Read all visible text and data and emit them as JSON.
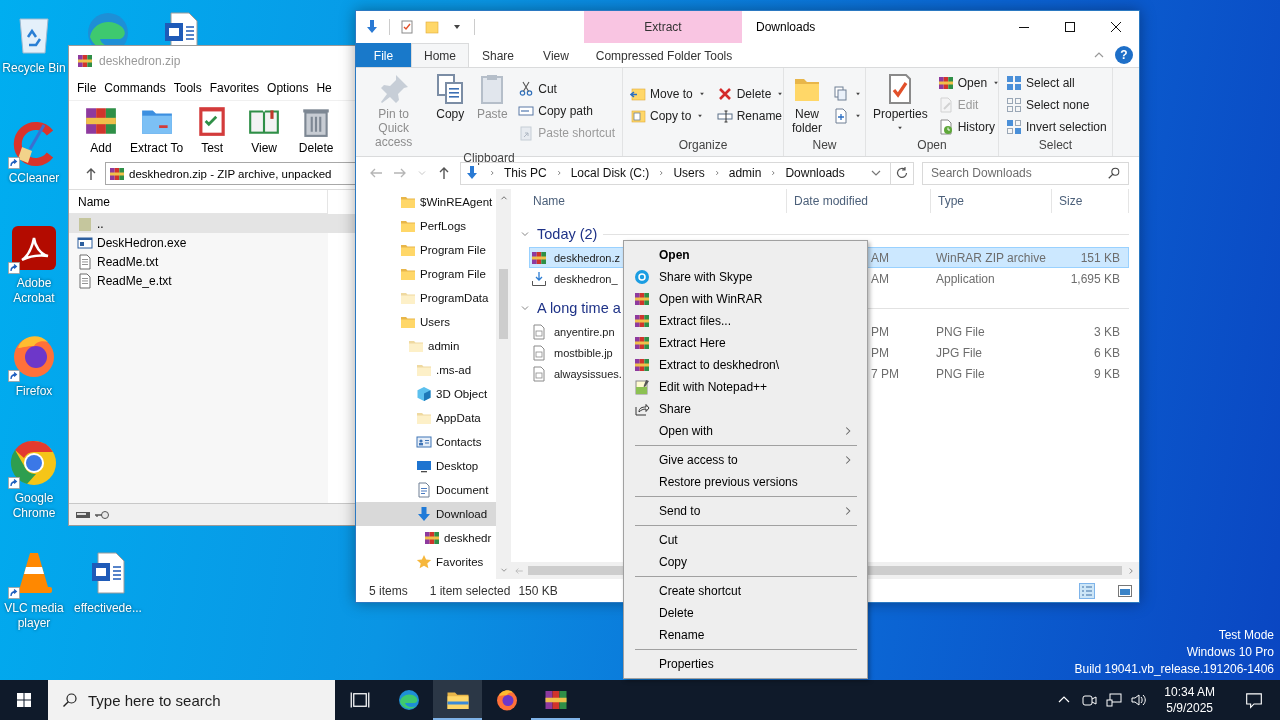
{
  "desktop": {
    "icons": [
      {
        "kind": "recycle",
        "label": "Recycle Bin",
        "shortcut": false
      },
      {
        "kind": "edge"
      },
      {
        "kind": "word"
      },
      {
        "kind": "ccleaner",
        "label": "CCleaner",
        "shortcut": true
      },
      {
        "kind": "acrobat",
        "label": "Adobe Acrobat",
        "shortcut": true
      },
      {
        "kind": "firefox",
        "label": "Firefox",
        "shortcut": true
      },
      {
        "kind": "chrome",
        "label": "Google Chrome",
        "shortcut": true
      },
      {
        "kind": "vlc",
        "label": "VLC media player",
        "shortcut": true
      },
      {
        "kind": "word",
        "label": "effectivede...",
        "shortcut": false
      }
    ],
    "edition_notice": [
      "Test Mode",
      "Windows 10 Pro",
      "Build 19041.vb_release.191206-1406"
    ]
  },
  "winrar": {
    "title": "deskhedron.zip",
    "menu": [
      "File",
      "Commands",
      "Tools",
      "Favorites",
      "Options",
      "He"
    ],
    "toolbar": [
      {
        "kind": "add",
        "label": "Add"
      },
      {
        "kind": "extractto",
        "label": "Extract To"
      },
      {
        "kind": "test",
        "label": "Test"
      },
      {
        "kind": "view",
        "label": "View"
      },
      {
        "kind": "trash",
        "label": "Delete"
      }
    ],
    "address": "deskhedron.zip - ZIP archive, unpacked",
    "columns": [
      "Name"
    ],
    "files": [
      {
        "kind": "up",
        "name": "..",
        "selected": true
      },
      {
        "kind": "exe",
        "name": "DeskHedron.exe",
        "selected": false
      },
      {
        "kind": "txt",
        "name": "ReadMe.txt",
        "selected": false
      },
      {
        "kind": "txt",
        "name": "ReadMe_e.txt",
        "selected": false
      }
    ]
  },
  "explorer": {
    "title": "Downloads",
    "context_tab": "Extract",
    "help_label": "?",
    "tabs": [
      {
        "kind": "file",
        "label": "File",
        "selected": false
      },
      {
        "kind": "normal",
        "label": "Home",
        "selected": true
      },
      {
        "kind": "normal",
        "label": "Share",
        "selected": false
      },
      {
        "kind": "normal",
        "label": "View",
        "selected": false
      },
      {
        "kind": "context",
        "label": "Compressed Folder Tools",
        "selected": false
      }
    ],
    "ribbon": [
      {
        "label": "Clipboard",
        "columns": [
          [
            {
              "kind": "pin",
              "label": "Pin to Quick access",
              "disabled": true,
              "dropdown": false
            }
          ],
          [
            {
              "kind": "copy",
              "label": "Copy",
              "disabled": false,
              "dropdown": false
            }
          ],
          [
            {
              "kind": "paste",
              "label": "Paste",
              "disabled": true,
              "dropdown": false
            }
          ],
          [
            {
              "kind": "cut",
              "label": "Cut",
              "disabled": false,
              "dropdown": false
            },
            {
              "kind": "copypath",
              "label": "Copy path",
              "disabled": false,
              "dropdown": false
            },
            {
              "kind": "pasteshortcut",
              "label": "Paste shortcut",
              "disabled": true,
              "dropdown": false
            }
          ]
        ]
      },
      {
        "label": "Organize",
        "columns": [
          [
            {
              "kind": "moveto",
              "label": "Move to",
              "disabled": false,
              "dropdown": true
            },
            {
              "kind": "copyto",
              "label": "Copy to",
              "disabled": false,
              "dropdown": true
            }
          ],
          [
            {
              "kind": "delete",
              "label": "Delete",
              "disabled": false,
              "dropdown": true
            },
            {
              "kind": "rename",
              "label": "Rename",
              "disabled": false,
              "dropdown": false
            }
          ]
        ]
      },
      {
        "label": "New",
        "columns": [
          [
            {
              "kind": "newfolder",
              "label": "New folder",
              "disabled": false,
              "dropdown": false
            }
          ],
          [
            {
              "kind": "newitem",
              "disabled": false,
              "dropdown": true
            },
            {
              "kind": "easyaccess",
              "disabled": false,
              "dropdown": true
            }
          ]
        ]
      },
      {
        "label": "Open",
        "columns": [
          [
            {
              "kind": "properties",
              "label": "Properties",
              "disabled": false,
              "dropdown": true
            }
          ],
          [
            {
              "kind": "winrar",
              "label": "Open",
              "disabled": false,
              "dropdown": true
            },
            {
              "kind": "edit",
              "label": "Edit",
              "disabled": true,
              "dropdown": false
            },
            {
              "kind": "history",
              "label": "History",
              "disabled": false,
              "dropdown": false
            }
          ]
        ]
      },
      {
        "label": "Select",
        "columns": [
          [
            {
              "kind": "selectall",
              "label": "Select all",
              "disabled": false,
              "dropdown": false
            },
            {
              "kind": "selectnone",
              "label": "Select none",
              "disabled": false,
              "dropdown": false
            },
            {
              "kind": "invert",
              "label": "Invert selection",
              "disabled": false,
              "dropdown": false
            }
          ]
        ]
      }
    ],
    "breadcrumbs": [
      "This PC",
      "Local Disk (C:)",
      "Users",
      "admin",
      "Downloads"
    ],
    "search": {
      "placeholder": "Search Downloads"
    },
    "tree": [
      {
        "kind": "folder",
        "label": "$WinREAgent",
        "selected": false
      },
      {
        "kind": "folder",
        "label": "PerfLogs",
        "selected": false
      },
      {
        "kind": "folder",
        "label": "Program File",
        "selected": false
      },
      {
        "kind": "folder",
        "label": "Program File",
        "selected": false
      },
      {
        "kind": "folderlight",
        "label": "ProgramData",
        "selected": false
      },
      {
        "kind": "folder",
        "label": "Users",
        "selected": false,
        "children": [
          {
            "kind": "folderlight",
            "label": "admin",
            "selected": false,
            "children": [
              {
                "kind": "folderlight",
                "label": ".ms-ad",
                "selected": false
              },
              {
                "kind": "cube",
                "label": "3D Object",
                "selected": false
              },
              {
                "kind": "folderlight",
                "label": "AppData",
                "selected": false
              },
              {
                "kind": "contacts",
                "label": "Contacts",
                "selected": false
              },
              {
                "kind": "desktop",
                "label": "Desktop",
                "selected": false
              },
              {
                "kind": "documents",
                "label": "Document",
                "selected": false
              },
              {
                "kind": "download",
                "label": "Download",
                "selected": true,
                "children": [
                  {
                    "kind": "winrar",
                    "label": "deskhedr",
                    "selected": false
                  }
                ]
              },
              {
                "kind": "star",
                "label": "Favorites",
                "selected": false
              }
            ]
          }
        ]
      }
    ],
    "columns": [
      "Name",
      "Date modified",
      "Type",
      "Size"
    ],
    "groups": [
      {
        "label": "Today (2)",
        "files": [
          {
            "kind": "winrar",
            "name": "deskhedron.z",
            "date": "AM",
            "type": "WinRAR ZIP archive",
            "size": "151 KB",
            "selected": true
          },
          {
            "kind": "installer",
            "name": "deskhedron_",
            "date": "AM",
            "type": "Application",
            "size": "1,695 KB",
            "selected": false
          }
        ]
      },
      {
        "label": "A long time a",
        "files": [
          {
            "kind": "image",
            "name": "anyentire.pn",
            "date": "PM",
            "type": "PNG File",
            "size": "3 KB",
            "selected": false
          },
          {
            "kind": "image",
            "name": "mostbible.jp",
            "date": "PM",
            "type": "JPG File",
            "size": "6 KB",
            "selected": false
          },
          {
            "kind": "image",
            "name": "alwaysissues.",
            "date": "7 PM",
            "type": "PNG File",
            "size": "9 KB",
            "selected": false
          }
        ]
      }
    ],
    "status": {
      "count": "5 items",
      "selection": "1 item selected",
      "size": "150 KB"
    }
  },
  "context_menu": {
    "items": [
      {
        "kind": "plain",
        "label": "Open",
        "default": true,
        "submenu": false
      },
      {
        "kind": "skype",
        "label": "Share with Skype",
        "default": false,
        "submenu": false
      },
      {
        "kind": "winrar",
        "label": "Open with WinRAR",
        "default": false,
        "submenu": false
      },
      {
        "kind": "winrar",
        "label": "Extract files...",
        "default": false,
        "submenu": false
      },
      {
        "kind": "winrar",
        "label": "Extract Here",
        "default": false,
        "submenu": false
      },
      {
        "kind": "winrar",
        "label": "Extract to deskhedron\\",
        "default": false,
        "submenu": false
      },
      {
        "kind": "notepad",
        "label": "Edit with Notepad++",
        "default": false,
        "submenu": false
      },
      {
        "kind": "share",
        "label": "Share",
        "default": false,
        "submenu": false
      },
      {
        "kind": "plain",
        "label": "Open with",
        "default": false,
        "submenu": true
      },
      {
        "kind": "separator"
      },
      {
        "kind": "plain",
        "label": "Give access to",
        "default": false,
        "submenu": true
      },
      {
        "kind": "plain",
        "label": "Restore previous versions",
        "default": false,
        "submenu": false
      },
      {
        "kind": "separator"
      },
      {
        "kind": "plain",
        "label": "Send to",
        "default": false,
        "submenu": true
      },
      {
        "kind": "separator"
      },
      {
        "kind": "plain",
        "label": "Cut",
        "default": false,
        "submenu": false
      },
      {
        "kind": "plain",
        "label": "Copy",
        "default": false,
        "submenu": false
      },
      {
        "kind": "separator"
      },
      {
        "kind": "plain",
        "label": "Create shortcut",
        "default": false,
        "submenu": false
      },
      {
        "kind": "plain",
        "label": "Delete",
        "default": false,
        "submenu": false
      },
      {
        "kind": "plain",
        "label": "Rename",
        "default": false,
        "submenu": false
      },
      {
        "kind": "separator"
      },
      {
        "kind": "plain",
        "label": "Properties",
        "default": false,
        "submenu": false
      }
    ]
  },
  "taskbar": {
    "search": {
      "placeholder": "Type here to search"
    },
    "apps": [
      {
        "kind": "taskview",
        "running": false,
        "focused": false
      },
      {
        "kind": "edge",
        "running": false,
        "focused": false
      },
      {
        "kind": "explorer",
        "running": true,
        "focused": true
      },
      {
        "kind": "firefox",
        "running": false,
        "focused": false
      },
      {
        "kind": "winrar",
        "running": true,
        "focused": false
      }
    ],
    "time": "10:34 AM",
    "date": "5/9/2025"
  }
}
